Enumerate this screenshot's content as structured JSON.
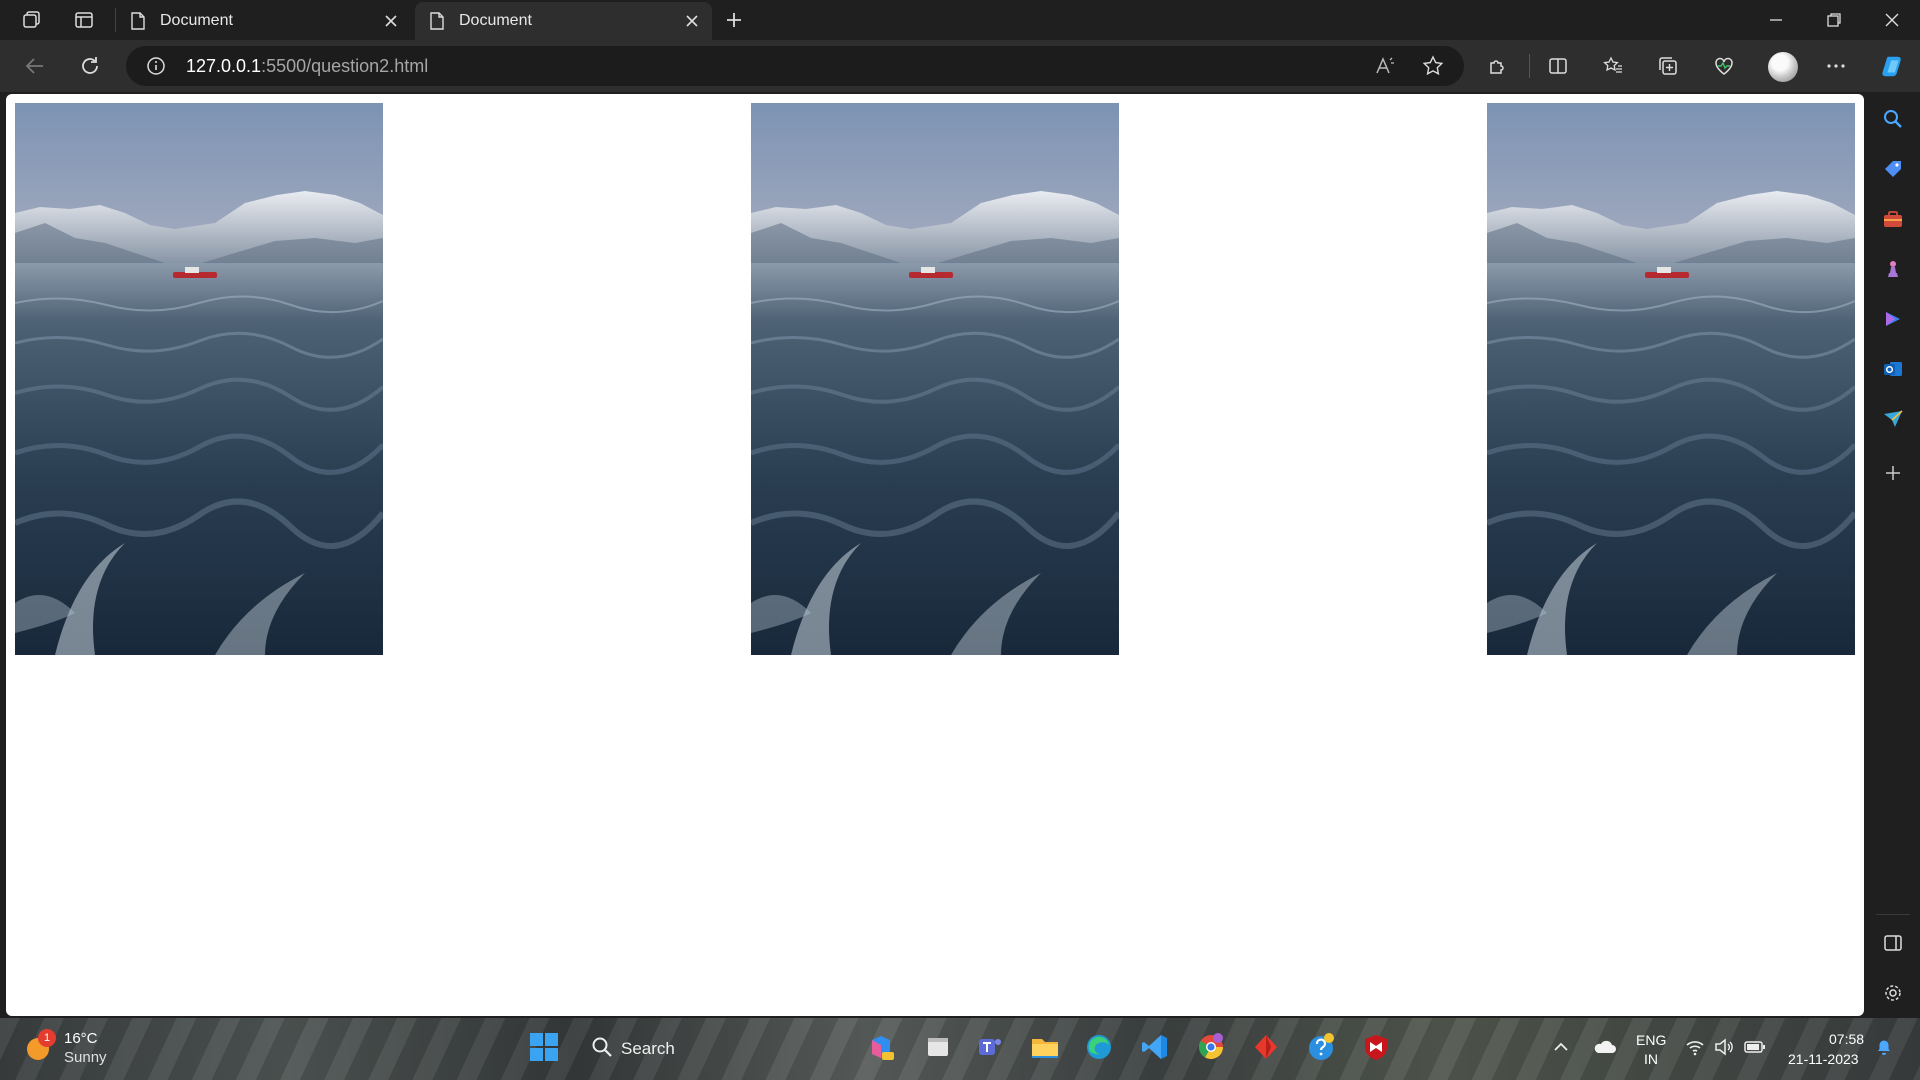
{
  "browser": {
    "tabs": [
      {
        "title": "Document",
        "active": false
      },
      {
        "title": "Document",
        "active": true
      }
    ],
    "address": {
      "host": "127.0.0.1",
      "path": ":5500/question2.html"
    }
  },
  "page": {
    "images": [
      {
        "alt": "fjord-photo-1"
      },
      {
        "alt": "fjord-photo-2"
      },
      {
        "alt": "fjord-photo-3"
      }
    ]
  },
  "taskbar": {
    "weather": {
      "temp": "16°C",
      "condition": "Sunny",
      "badge": "1"
    },
    "search_label": "Search",
    "language": {
      "line1": "ENG",
      "line2": "IN"
    },
    "clock": {
      "time": "07:58",
      "date": "21-11-2023"
    }
  },
  "colors": {
    "chrome_bg": "#1f1f1f",
    "toolbar_bg": "#2e2e2e",
    "address_bg": "#1c1c1c",
    "page_bg": "#ffffff"
  },
  "icons": {
    "sidebar": [
      "search-icon",
      "tag-icon",
      "toolbox-icon",
      "chess-icon",
      "copilot-icon",
      "outlook-icon",
      "send-icon",
      "plus-icon",
      "split-panel-icon",
      "settings-icon"
    ]
  }
}
